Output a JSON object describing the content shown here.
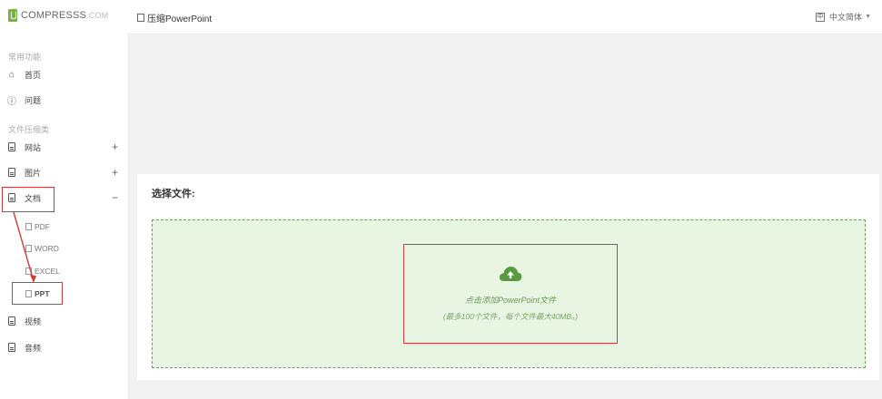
{
  "app": {
    "logo_text": "COMPRESSS",
    "logo_suffix": ".COM"
  },
  "sidebar": {
    "section_tools": "常用功能",
    "home": "首页",
    "help": "问题",
    "section_files": "文件压缩类",
    "items": [
      {
        "label": "网站",
        "toggle": "+"
      },
      {
        "label": "图片",
        "toggle": "+"
      },
      {
        "label": "文档",
        "toggle": "−"
      }
    ],
    "doc_sub": [
      "PDF",
      "WORD",
      "EXCEL",
      "PPT"
    ],
    "video": "视频",
    "audio": "音频"
  },
  "header": {
    "title": "压缩PowerPoint",
    "language": "中文简体",
    "language_icon_text": "中"
  },
  "main": {
    "select_label": "选择文件:",
    "drop_line1": "点击添加PowerPoint文件",
    "drop_line2": "(最多100个文件，每个文件最大40MB。)"
  },
  "colors": {
    "accent_green": "#7bb342",
    "drop_bg": "#e8f5e3",
    "annotation_red": "#d23b3b"
  },
  "icons": [
    "home-icon",
    "help-icon",
    "document-icon",
    "image-icon",
    "upload-cloud-icon",
    "language-icon",
    "chevron-down-icon"
  ]
}
